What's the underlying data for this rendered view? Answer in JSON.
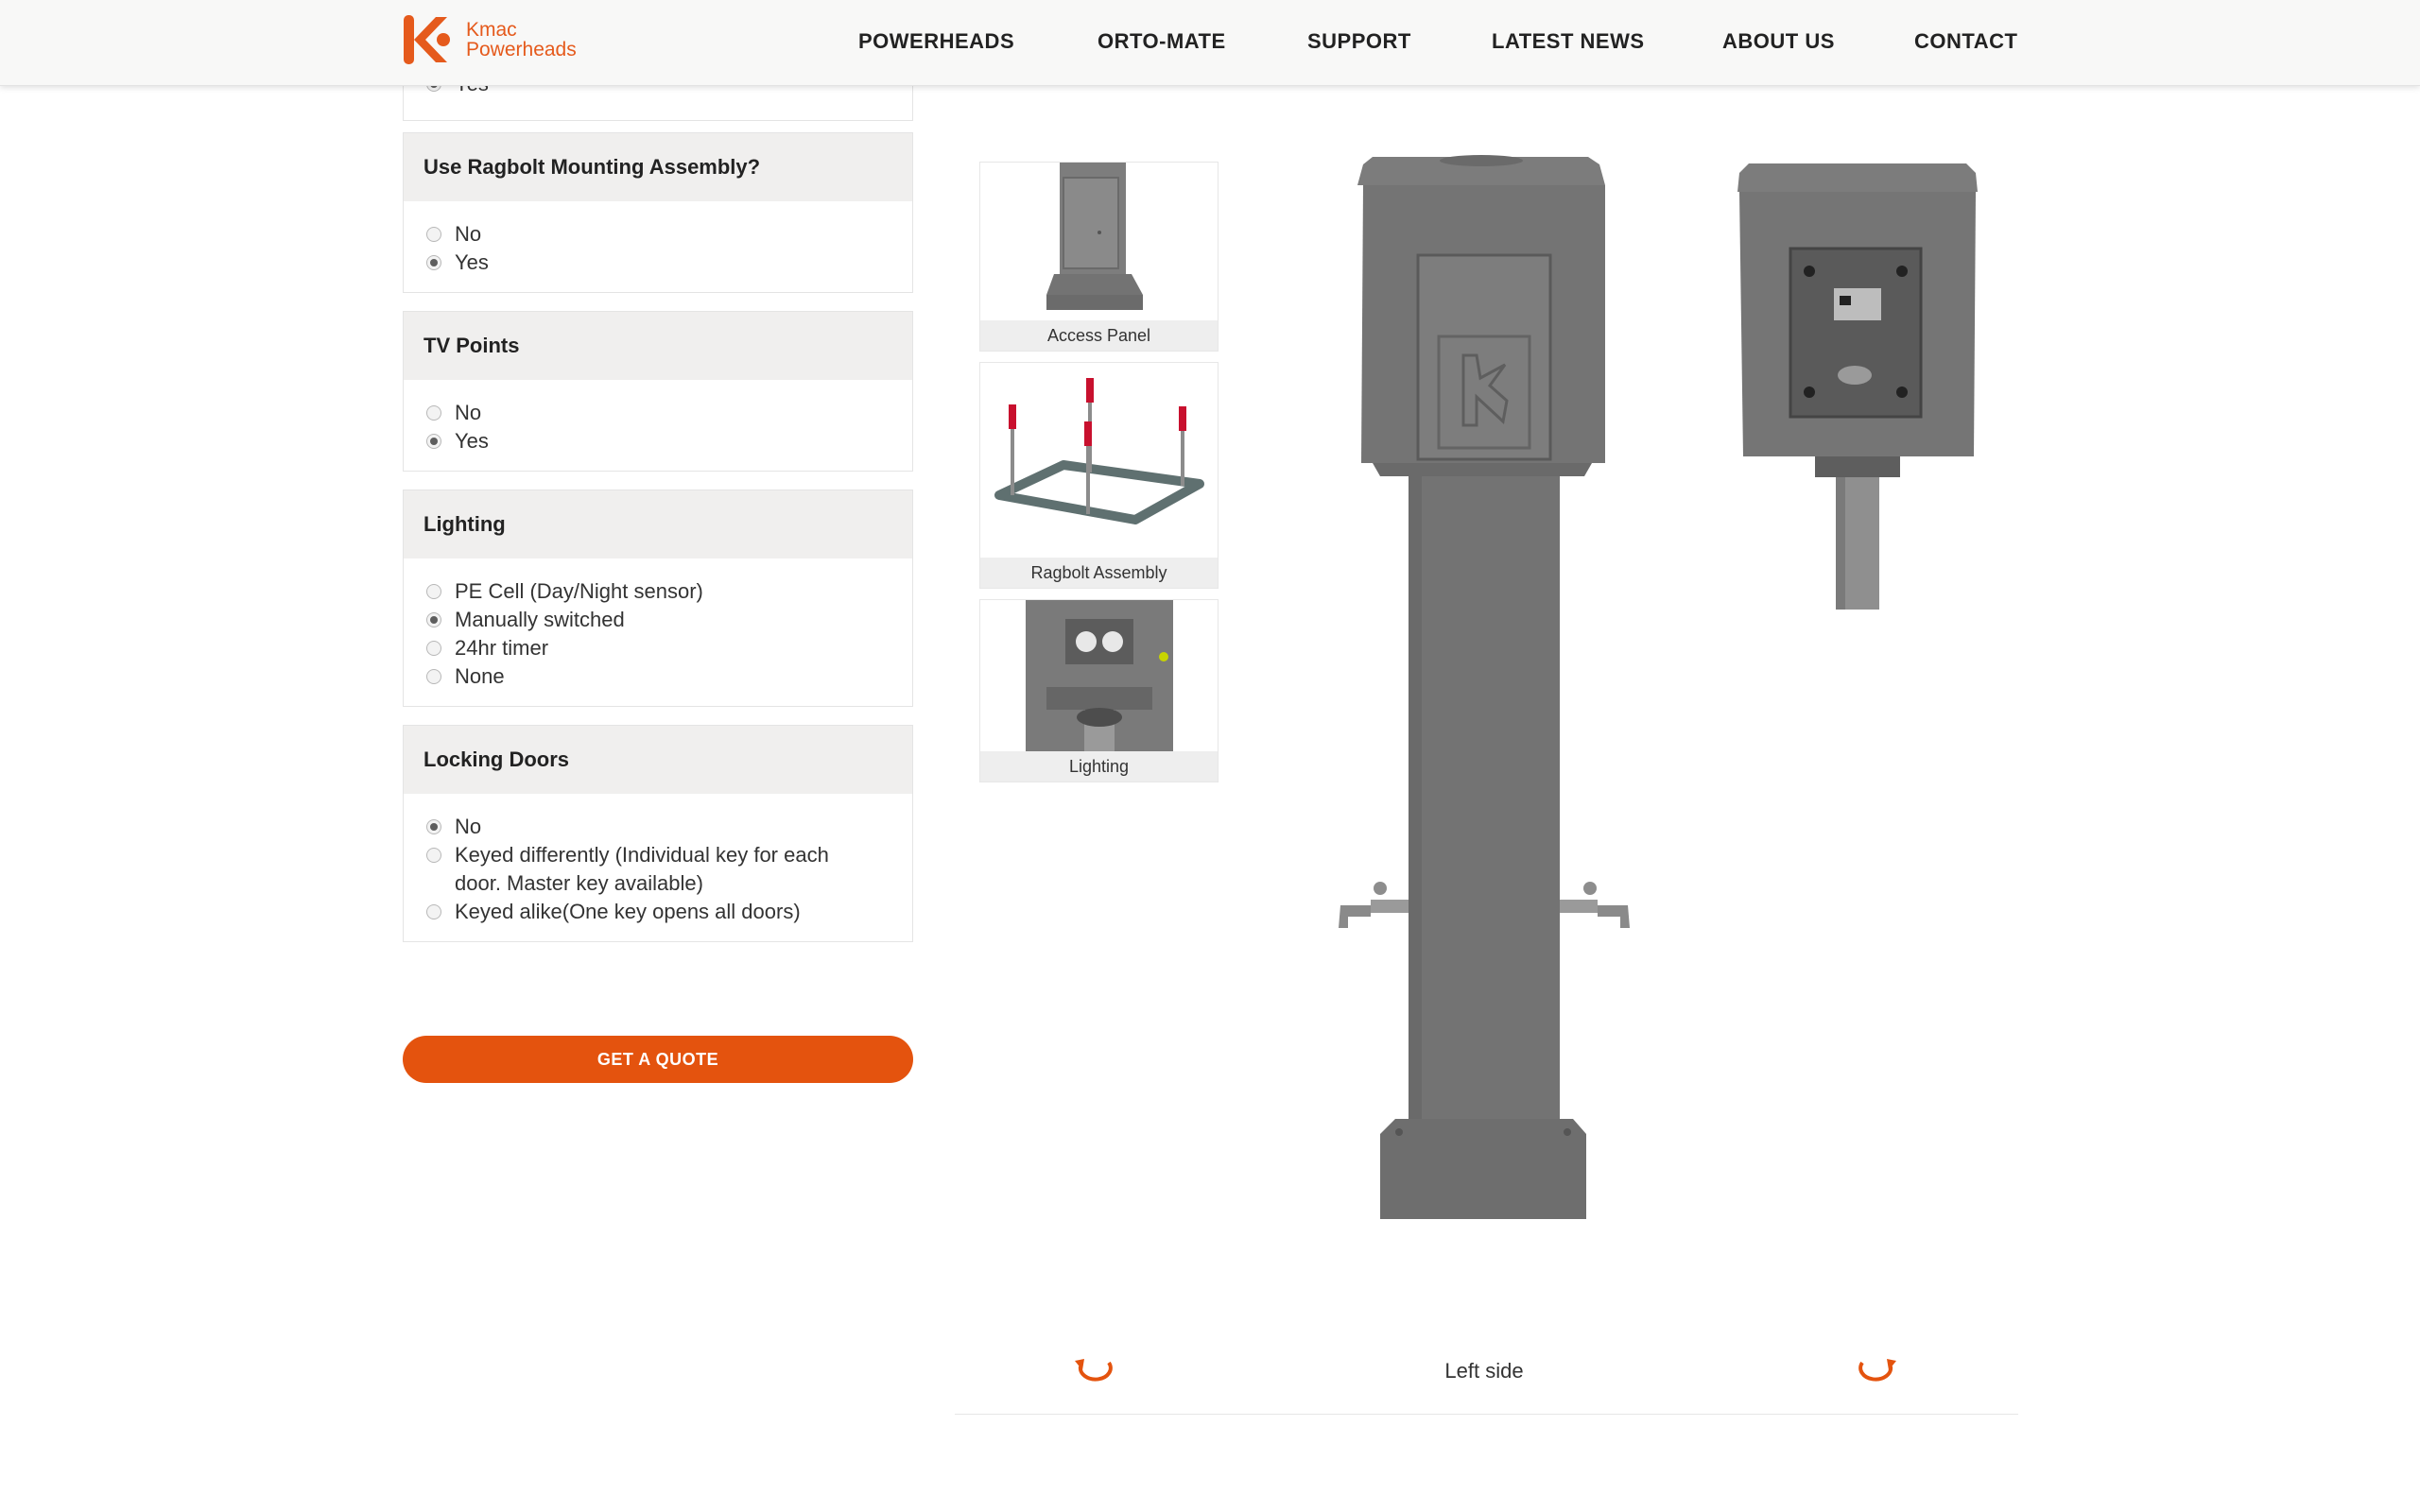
{
  "brand": {
    "line1": "Kmac",
    "line2": "Powerheads",
    "color": "#e55a1c"
  },
  "nav": [
    {
      "label": "POWERHEADS"
    },
    {
      "label": "ORTO-MATE"
    },
    {
      "label": "SUPPORT"
    },
    {
      "label": "LATEST NEWS"
    },
    {
      "label": "ABOUT US"
    },
    {
      "label": "CONTACT"
    }
  ],
  "partial_option": {
    "label": "Yes",
    "selected": true
  },
  "sections": [
    {
      "title": "Use Ragbolt Mounting Assembly?",
      "options": [
        {
          "label": "No",
          "selected": false
        },
        {
          "label": "Yes",
          "selected": true
        }
      ]
    },
    {
      "title": "TV Points",
      "options": [
        {
          "label": "No",
          "selected": false
        },
        {
          "label": "Yes",
          "selected": true
        }
      ]
    },
    {
      "title": "Lighting",
      "options": [
        {
          "label": "PE Cell (Day/Night sensor)",
          "selected": false
        },
        {
          "label": "Manually switched",
          "selected": true
        },
        {
          "label": "24hr timer",
          "selected": false
        },
        {
          "label": "None",
          "selected": false
        }
      ]
    },
    {
      "title": "Locking Doors",
      "options": [
        {
          "label": "No",
          "selected": true
        },
        {
          "label": "Keyed differently (Individual key for each door. Master key available)",
          "selected": false
        },
        {
          "label": "Keyed alike(One key opens all doors)",
          "selected": false
        }
      ]
    }
  ],
  "quote_button": "GET A QUOTE",
  "thumbnails": [
    {
      "caption": "Access Panel"
    },
    {
      "caption": "Ragbolt Assembly"
    },
    {
      "caption": "Lighting"
    }
  ],
  "viewer": {
    "label": "Left side",
    "rotate_left_icon": "rotate-left-icon",
    "rotate_right_icon": "rotate-right-icon"
  },
  "colors": {
    "accent": "#e4530e",
    "product_grey": "#6f6f6f"
  }
}
